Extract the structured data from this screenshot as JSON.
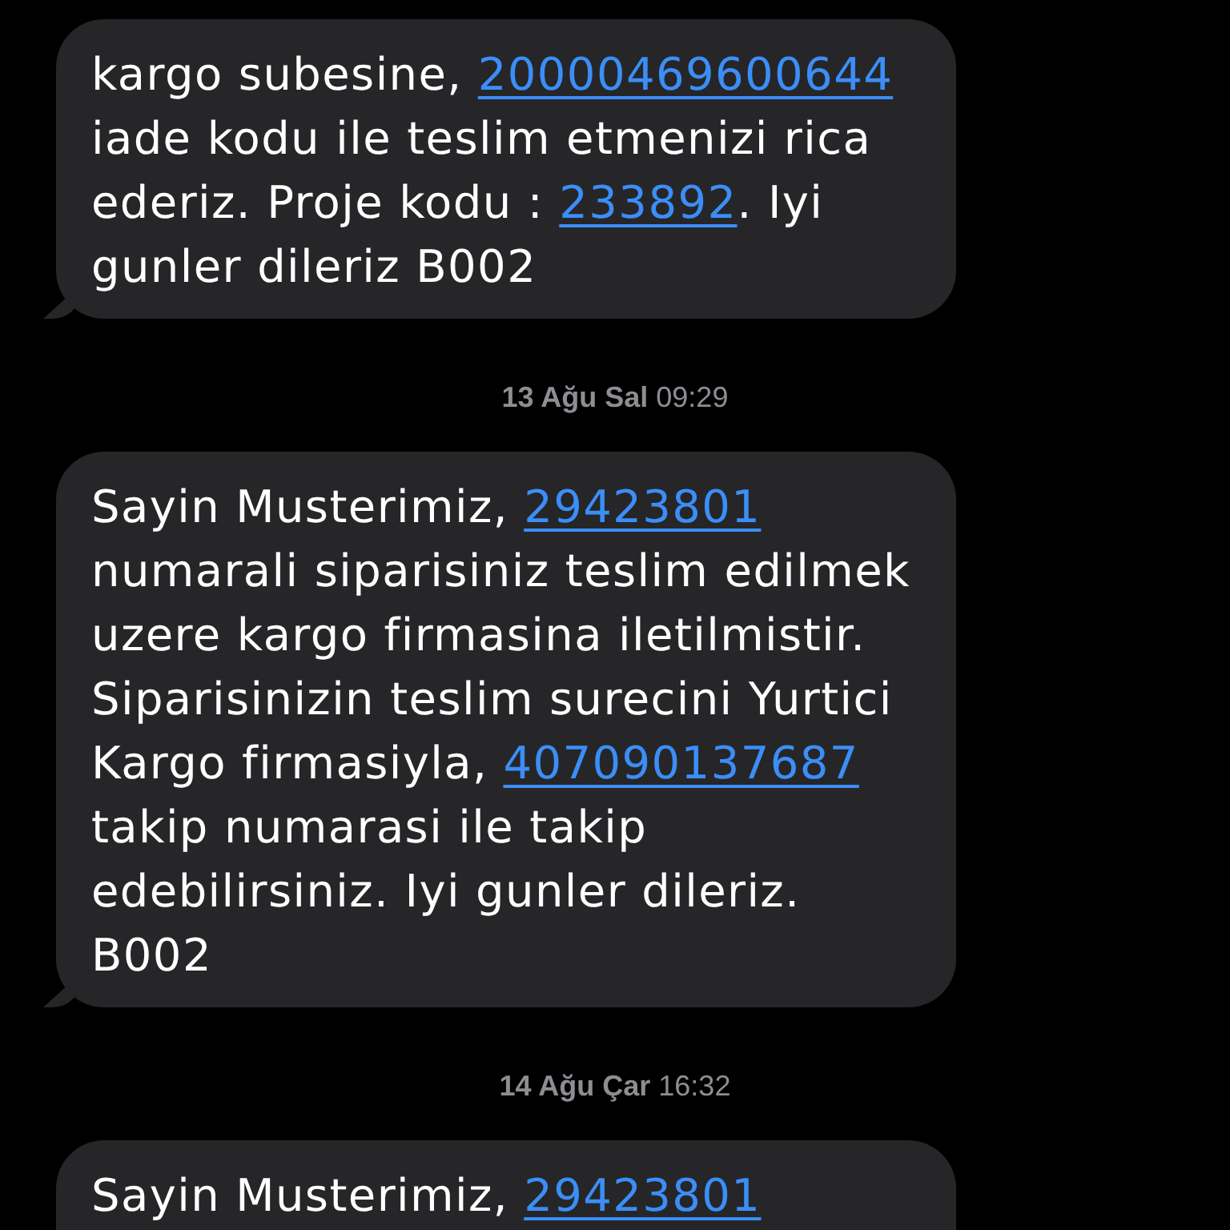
{
  "thread": [
    {
      "kind": "message",
      "segments": [
        {
          "kind": "text",
          "text": "kargo subesine, "
        },
        {
          "kind": "link",
          "text": "20000469600644"
        },
        {
          "kind": "text",
          "text": " iade kodu ile teslim etmenizi rica ederiz. Proje kodu : "
        },
        {
          "kind": "link",
          "text": "233892"
        },
        {
          "kind": "text",
          "text": ". Iyi gunler dileriz B002"
        }
      ]
    },
    {
      "kind": "timestamp",
      "date": "13 Ağu Sal",
      "time": "09:29"
    },
    {
      "kind": "message",
      "segments": [
        {
          "kind": "text",
          "text": "Sayin Musterimiz, "
        },
        {
          "kind": "link",
          "text": "29423801"
        },
        {
          "kind": "text",
          "text": " numarali siparisiniz teslim edilmek uzere kargo firmasina iletilmistir. Siparisinizin teslim surecini Yurtici Kargo firmasiyla, "
        },
        {
          "kind": "link",
          "text": "407090137687"
        },
        {
          "kind": "text",
          "text": " takip numarasi ile takip edebilirsiniz. Iyi gunler dileriz. B002"
        }
      ]
    },
    {
      "kind": "timestamp",
      "date": "14 Ağu Çar",
      "time": "16:32"
    },
    {
      "kind": "message",
      "segments": [
        {
          "kind": "text",
          "text": "Sayin Musterimiz, "
        },
        {
          "kind": "link",
          "text": "29423801"
        }
      ]
    }
  ]
}
